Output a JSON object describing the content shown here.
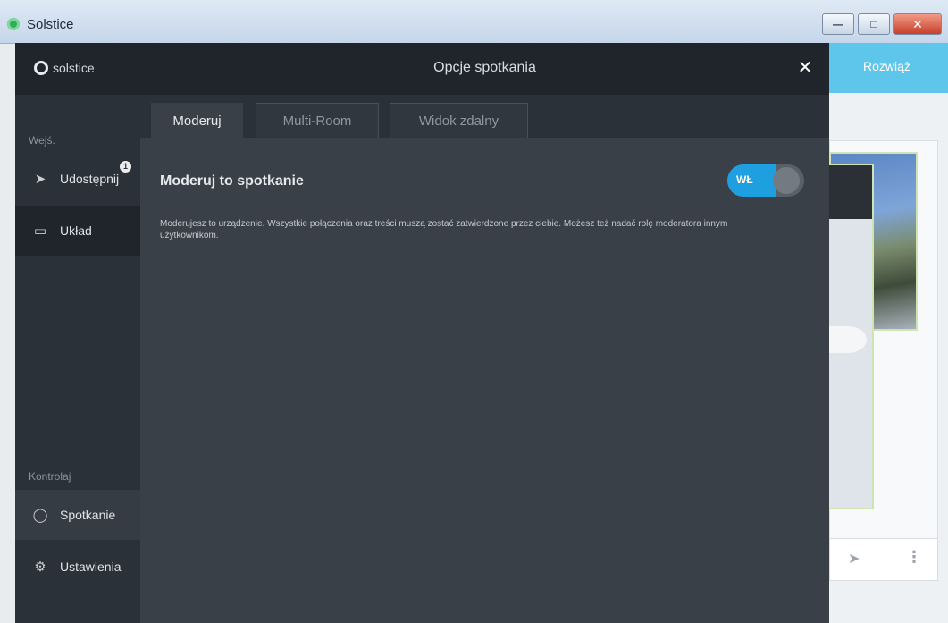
{
  "window": {
    "title": "Solstice",
    "minimize": "—",
    "maximize": "□",
    "close": "✕"
  },
  "sidebar": {
    "brand": "solstice",
    "section_share": "Wejś.",
    "items": [
      {
        "label": "Udostępnij",
        "icon": "share-icon",
        "badge": "1"
      },
      {
        "label": "Układ",
        "icon": "layout-icon"
      }
    ],
    "section_controls": "Kontrolaj",
    "controls": [
      {
        "label": "Spotkanie",
        "icon": "meeting-icon"
      },
      {
        "label": "Ustawienia",
        "icon": "settings-gear-icon"
      }
    ]
  },
  "background": {
    "close_label": "Rozwiąż"
  },
  "modal": {
    "title": "Opcje spotkania",
    "tabs": [
      {
        "label": "Moderuj",
        "active": true
      },
      {
        "label": "Multi-Room",
        "active": false
      },
      {
        "label": "Widok zdalny",
        "active": false
      }
    ],
    "section_title": "Moderuj to spotkanie",
    "toggle": {
      "label": "WŁ",
      "state": "on"
    },
    "description": "Moderujesz to urządzenie. Wszystkie połączenia oraz treści muszą zostać zatwierdzone przez ciebie. Możesz też nadać rolę moderatora innym użytkownikom."
  },
  "colors": {
    "accent": "#1e9fe0",
    "sidebar_bg": "#2b3138",
    "modal_bg": "#3a4048",
    "header_bg": "#20252b",
    "bg_header": "#5ec6ea"
  }
}
